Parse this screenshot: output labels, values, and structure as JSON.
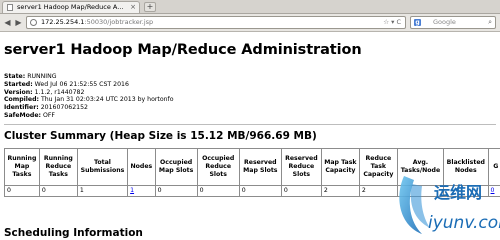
{
  "browser": {
    "tab_title": "server1 Hadoop Map/Reduce A...",
    "new_tab_label": "+",
    "url_host": "172.25.254.1",
    "url_path": ":50030/jobtracker.jsp",
    "url_right_glyph": "☆ ▾ C",
    "search_placeholder": "Google",
    "search_icon_label": "g",
    "back_label": "◀",
    "forward_label": "▶",
    "tab_close_label": "×"
  },
  "page": {
    "title": "server1 Hadoop Map/Reduce Administration",
    "status": [
      {
        "key": "State:",
        "value": "RUNNING"
      },
      {
        "key": "Started:",
        "value": "Wed Jul 06 21:52:55 CST 2016"
      },
      {
        "key": "Version:",
        "value": "1.1.2, r1440782"
      },
      {
        "key": "Compiled:",
        "value": "Thu Jan 31 02:03:24 UTC 2013 by hortonfo"
      },
      {
        "key": "Identifier:",
        "value": "201607062152"
      },
      {
        "key": "SafeMode:",
        "value": "OFF"
      }
    ],
    "cluster_summary_title": "Cluster Summary (Heap Size is 15.12 MB/966.69 MB)",
    "table": {
      "headers": [
        "Running Map Tasks",
        "Running Reduce Tasks",
        "Total Submissions",
        "Nodes",
        "Occupied Map Slots",
        "Occupied Reduce Slots",
        "Reserved Map Slots",
        "Reserved Reduce Slots",
        "Map Task Capacity",
        "Reduce Task Capacity",
        "Avg. Tasks/Node",
        "Blacklisted Nodes",
        "G"
      ],
      "row": [
        "0",
        "0",
        "1",
        "1",
        "0",
        "0",
        "0",
        "0",
        "2",
        "2",
        "",
        "",
        "0"
      ]
    },
    "scheduling_title": "Scheduling Information"
  },
  "watermark": {
    "cn": "运维网",
    "url": "iyunv.com"
  }
}
